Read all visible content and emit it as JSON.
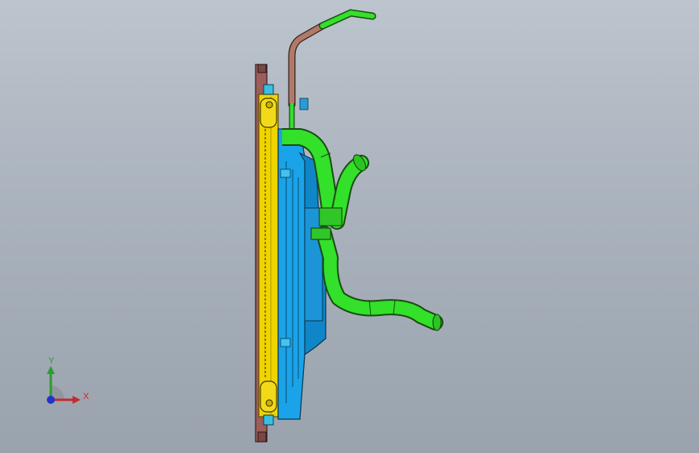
{
  "viewport": {
    "background_top": "#bcc4cd",
    "background_bottom": "#9aa3ad"
  },
  "model": {
    "parts": [
      {
        "name": "radiator-core",
        "color": "#f0d400"
      },
      {
        "name": "radiator-end-tanks",
        "color": "#9c5e5b"
      },
      {
        "name": "fan-shroud",
        "color": "#1aa3e8"
      },
      {
        "name": "coolant-hoses",
        "color": "#33e02a"
      },
      {
        "name": "metal-tube",
        "color": "#b07a6a"
      }
    ]
  },
  "triad": {
    "y_label": "Y",
    "x_label": "X",
    "y_color": "#2f9a2f",
    "x_color": "#c62b2b",
    "z_color": "#2233cc"
  }
}
